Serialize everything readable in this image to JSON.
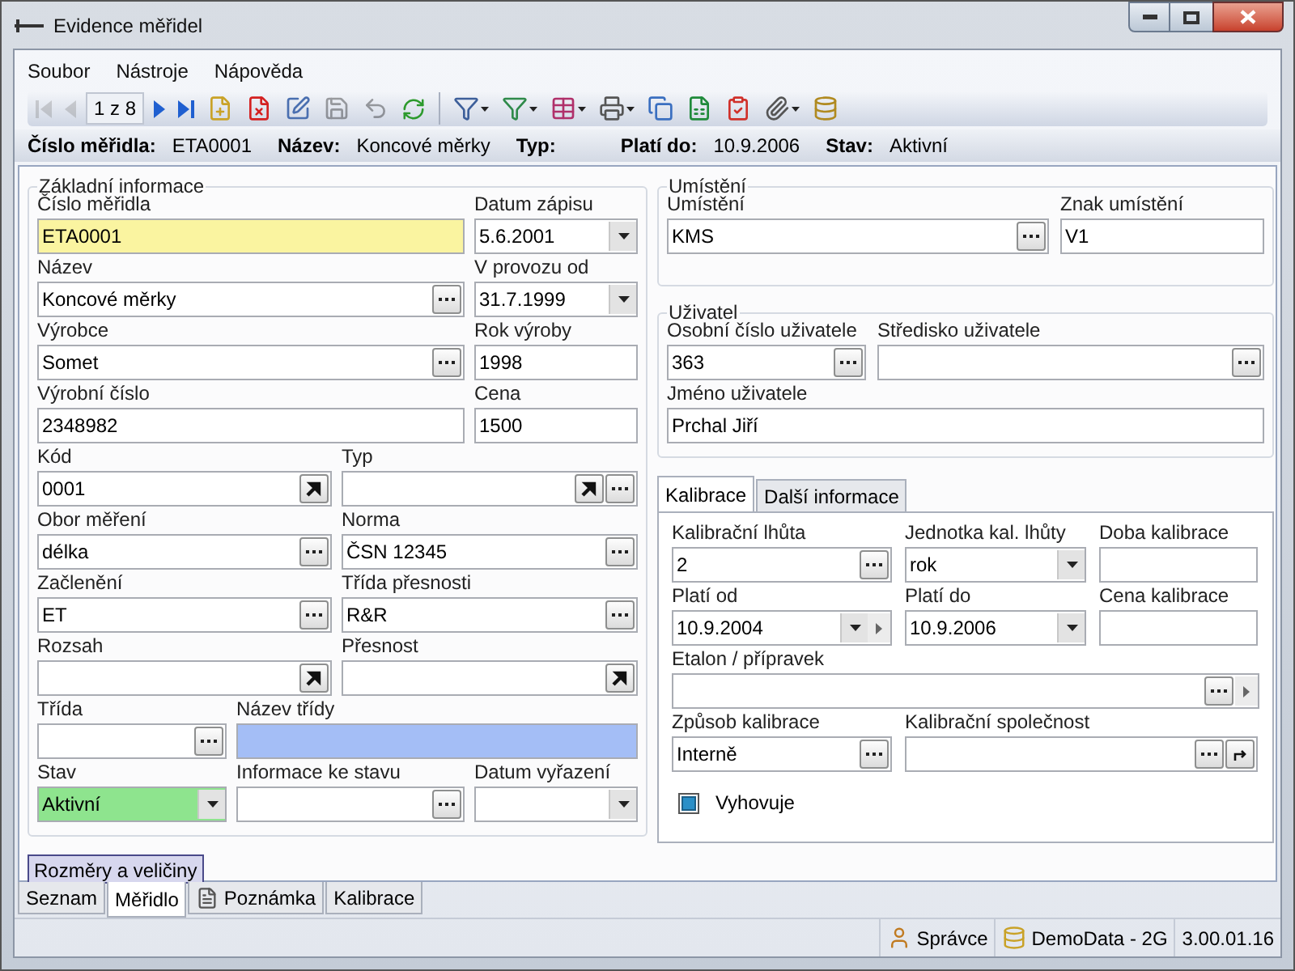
{
  "window": {
    "title": "Evidence měřidel"
  },
  "menu": [
    {
      "label": "Soubor"
    },
    {
      "label": "Nástroje"
    },
    {
      "label": "Nápověda"
    }
  ],
  "toolbar": [
    {
      "kind": "button",
      "disabled": true
    },
    {
      "kind": "button",
      "disabled": true
    },
    {
      "kind": "position",
      "text": "1 z 8"
    },
    {
      "kind": "button",
      "disabled": false
    },
    {
      "kind": "button",
      "disabled": false
    },
    {
      "kind": "button",
      "disabled": false
    },
    {
      "kind": "button",
      "disabled": false
    },
    {
      "kind": "button",
      "disabled": false
    },
    {
      "kind": "button",
      "disabled": true
    },
    {
      "kind": "button",
      "disabled": true
    },
    {
      "kind": "button",
      "disabled": false
    },
    {
      "kind": "separator"
    },
    {
      "kind": "menu-button",
      "disabled": false
    },
    {
      "kind": "menu-button",
      "disabled": false
    },
    {
      "kind": "menu-button",
      "disabled": false
    },
    {
      "kind": "menu-button",
      "disabled": false
    },
    {
      "kind": "button",
      "disabled": false
    },
    {
      "kind": "button",
      "disabled": false
    },
    {
      "kind": "button",
      "disabled": false
    },
    {
      "kind": "menu-button",
      "disabled": false
    },
    {
      "kind": "button",
      "disabled": false
    }
  ],
  "info_bar": [
    {
      "label": "Číslo měřidla:",
      "value": "ETA0001"
    },
    {
      "label": "Název:",
      "value": "Koncové měrky"
    },
    {
      "label": "Typ:"
    },
    {
      "label": "Platí do:",
      "value": "10.9.2006"
    },
    {
      "label": "Stav:",
      "value": "Aktivní"
    }
  ],
  "basic_info": {
    "title": "Základní informace",
    "rows": [
      [
        {
          "label": "Číslo měřidla",
          "value": "ETA0001",
          "kind": "text",
          "color": "#faf4a0"
        },
        {
          "label": "Datum zápisu",
          "value": "5.6.2001",
          "kind": "combo"
        }
      ],
      [
        {
          "label": "Název",
          "value": "Koncové měrky",
          "kind": "lookup"
        },
        {
          "label": "V provozu od",
          "value": "31.7.1999",
          "kind": "combo"
        }
      ],
      [
        {
          "label": "Výrobce",
          "value": "Somet",
          "kind": "lookup"
        },
        {
          "label": "Rok výroby",
          "value": "1998",
          "kind": "text"
        }
      ],
      [
        {
          "label": "Výrobní číslo",
          "value": "2348982",
          "kind": "text"
        },
        {
          "label": "Cena",
          "value": "1500",
          "kind": "text"
        }
      ],
      [
        {
          "label": "Kód",
          "value": "0001",
          "kind": "link"
        },
        {
          "label": "Typ",
          "kind": "link-lookup"
        }
      ],
      [
        {
          "label": "Obor měření",
          "value": "délka",
          "kind": "lookup"
        },
        {
          "label": "Norma",
          "value": "ČSN 12345",
          "kind": "lookup"
        }
      ],
      [
        {
          "label": "Začlenění",
          "value": "ET",
          "kind": "lookup"
        },
        {
          "label": "Třída přesnosti",
          "value": "R&R",
          "kind": "lookup"
        }
      ],
      [
        {
          "label": "Rozsah",
          "kind": "link"
        },
        {
          "label": "Přesnost",
          "kind": "link"
        }
      ],
      [
        {
          "label": "Třída",
          "kind": "lookup"
        },
        {
          "label": "Název třídy",
          "kind": "text",
          "color": "#a4bef6"
        }
      ],
      [
        {
          "label": "Stav",
          "value": "Aktivní",
          "kind": "combo",
          "color": "#8ee48e"
        },
        {
          "label": "Informace ke stavu",
          "kind": "lookup"
        },
        {
          "label": "Datum vyřazení",
          "kind": "combo"
        }
      ]
    ]
  },
  "location": {
    "title": "Umístění",
    "rows": [
      [
        {
          "label": "Umístění",
          "value": "KMS",
          "kind": "lookup"
        },
        {
          "label": "Znak umístění",
          "value": "V1",
          "kind": "text"
        }
      ]
    ]
  },
  "user": {
    "title": "Uživatel",
    "rows": [
      [
        {
          "label": "Osobní číslo uživatele",
          "value": "363",
          "kind": "lookup"
        },
        {
          "label": "Středisko uživatele",
          "kind": "lookup"
        }
      ],
      [
        {
          "label": "Jméno uživatele",
          "value": "Prchal Jiří",
          "kind": "text"
        }
      ]
    ]
  },
  "detail_tabs": [
    {
      "label": "Kalibrace",
      "selected": true
    },
    {
      "label": "Další informace",
      "selected": false
    }
  ],
  "calibration": {
    "rows": [
      [
        {
          "label": "Kalibrační lhůta",
          "value": "2",
          "kind": "lookup"
        },
        {
          "label": "Jednotka kal. lhůty",
          "value": "rok",
          "kind": "combo"
        },
        {
          "label": "Doba kalibrace",
          "kind": "text"
        }
      ],
      [
        {
          "label": "Platí od",
          "value": "10.9.2004",
          "kind": "combo-next"
        },
        {
          "label": "Platí do",
          "value": "10.9.2006",
          "kind": "combo"
        },
        {
          "label": "Cena kalibrace",
          "kind": "text"
        }
      ],
      [
        {
          "label": "Etalon / přípravek",
          "kind": "lookup-next"
        }
      ],
      [
        {
          "label": "Způsob kalibrace",
          "value": "Interně",
          "kind": "lookup"
        },
        {
          "label": "Kalibrační společnost",
          "kind": "lookup-refresh"
        }
      ]
    ],
    "checkbox": {
      "label": "Vyhovuje",
      "checked": true
    }
  },
  "dimensions_button": "Rozměry a veličiny",
  "bottom_tabs": [
    {
      "label": "Seznam",
      "selected": false
    },
    {
      "label": "Měřidlo",
      "selected": true
    },
    {
      "label": "Poznámka",
      "selected": false,
      "kind": "note"
    },
    {
      "label": "Kalibrace",
      "selected": false
    }
  ],
  "status_bar": [
    {
      "kind": "user",
      "text": "Správce"
    },
    {
      "kind": "database",
      "text": "DemoData - 2G"
    },
    {
      "kind": "plain",
      "text": "3.00.01.16"
    }
  ]
}
